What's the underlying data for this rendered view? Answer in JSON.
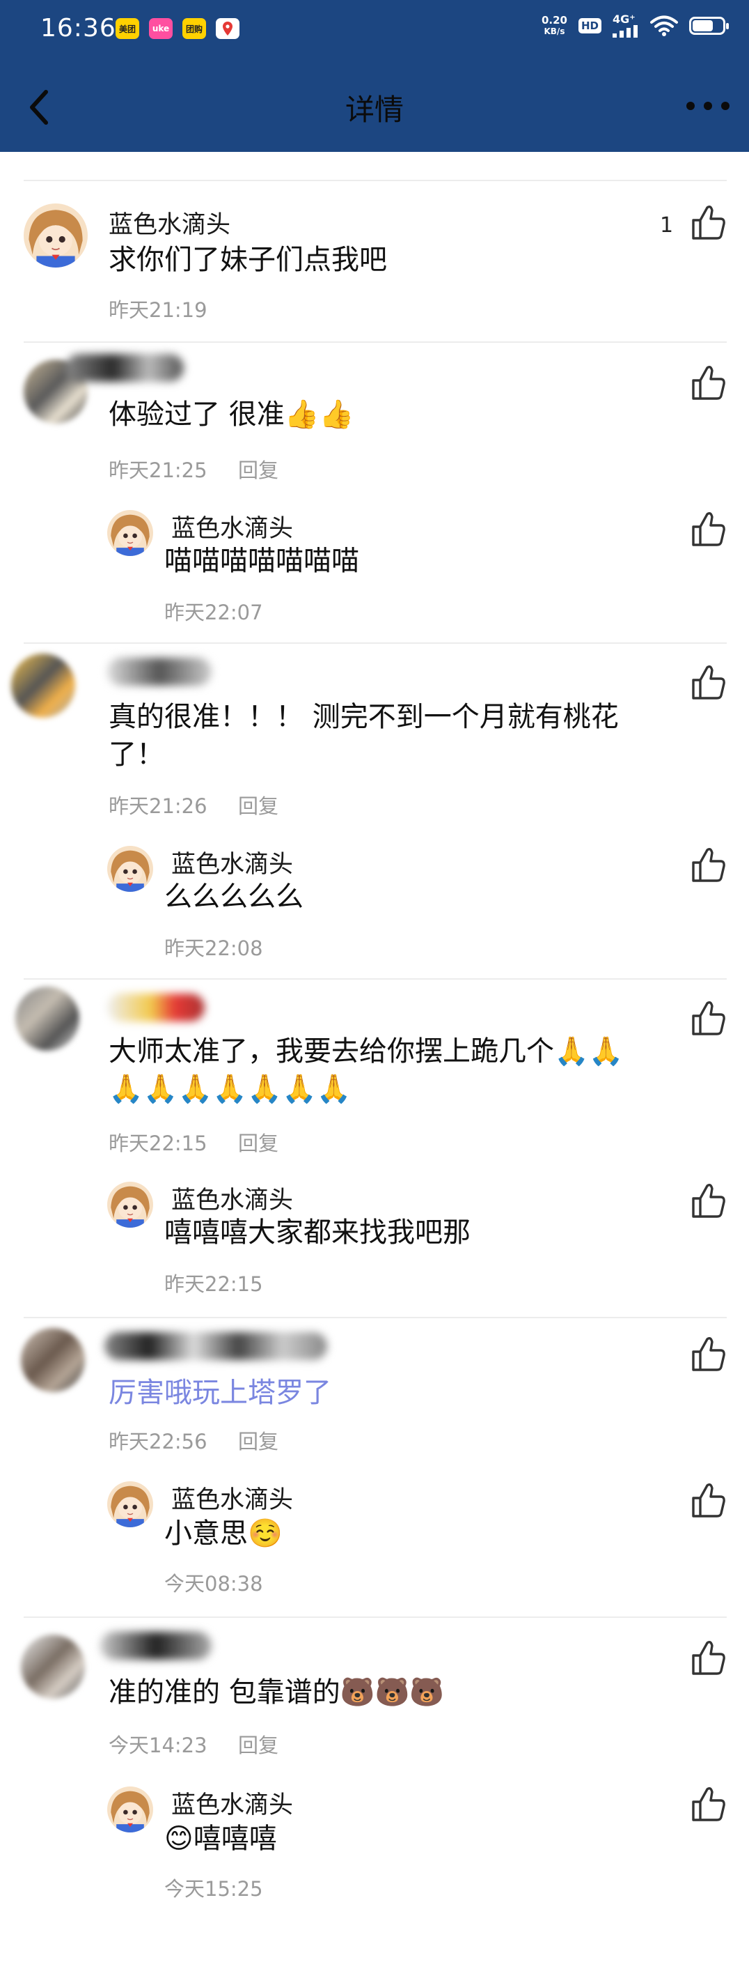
{
  "status_bar": {
    "time": "16:36",
    "net_speed_value": "0.20",
    "net_speed_unit": "KB/s",
    "hd": "HD",
    "network": "4G⁺",
    "app_badges": [
      {
        "icon": "meituan-icon",
        "text": "美团",
        "color": "#ffd100"
      },
      {
        "icon": "app-pink-icon",
        "text": "uke",
        "color": "#ff4fa0"
      },
      {
        "icon": "app-yellow-icon",
        "text": "团购",
        "color": "#ffd100"
      },
      {
        "icon": "map-pin-icon",
        "text": "",
        "color": "#ffffff"
      }
    ]
  },
  "nav": {
    "title": "详情",
    "back_icon": "chevron-left-icon",
    "more_icon": "more-horizontal-icon"
  },
  "colors": {
    "nav_bg": "#1c4681",
    "link_text": "#7a86e0",
    "meta_text": "#9a9a9a"
  },
  "comments": [
    {
      "username": "蓝色水滴头",
      "content": "求你们了妹子们点我吧",
      "time": "昨天21:19",
      "likes": "1",
      "replies": []
    },
    {
      "username": "",
      "content": "体验过了 很准👍👍",
      "time": "昨天21:25",
      "reply_label": "回复",
      "replies": [
        {
          "username": "蓝色水滴头",
          "content": "喵喵喵喵喵喵喵",
          "time": "昨天22:07"
        }
      ]
    },
    {
      "username": "",
      "content": "真的很准！！！ 测完不到一个月就有桃花\n了！",
      "time": "昨天21:26",
      "reply_label": "回复",
      "replies": [
        {
          "username": "蓝色水滴头",
          "content": "么么么么么",
          "time": "昨天22:08"
        }
      ]
    },
    {
      "username": "",
      "content": "大师太准了，我要去给你摆上跪几个🙏🙏\n🙏🙏🙏🙏🙏🙏🙏",
      "time": "昨天22:15",
      "reply_label": "回复",
      "replies": [
        {
          "username": "蓝色水滴头",
          "content": "嘻嘻嘻大家都来找我吧那",
          "time": "昨天22:15"
        }
      ]
    },
    {
      "username": "",
      "content": "厉害哦玩上塔罗了",
      "time": "昨天22:56",
      "reply_label": "回复",
      "replies": [
        {
          "username": "蓝色水滴头",
          "content": "小意思☺️",
          "time": "今天08:38"
        }
      ]
    },
    {
      "username": "",
      "content": "准的准的 包靠谱的🐻🐻🐻",
      "time": "今天14:23",
      "reply_label": "回复",
      "replies": [
        {
          "username": "蓝色水滴头",
          "content": "😊嘻嘻嘻",
          "time": "今天15:25"
        }
      ]
    }
  ]
}
